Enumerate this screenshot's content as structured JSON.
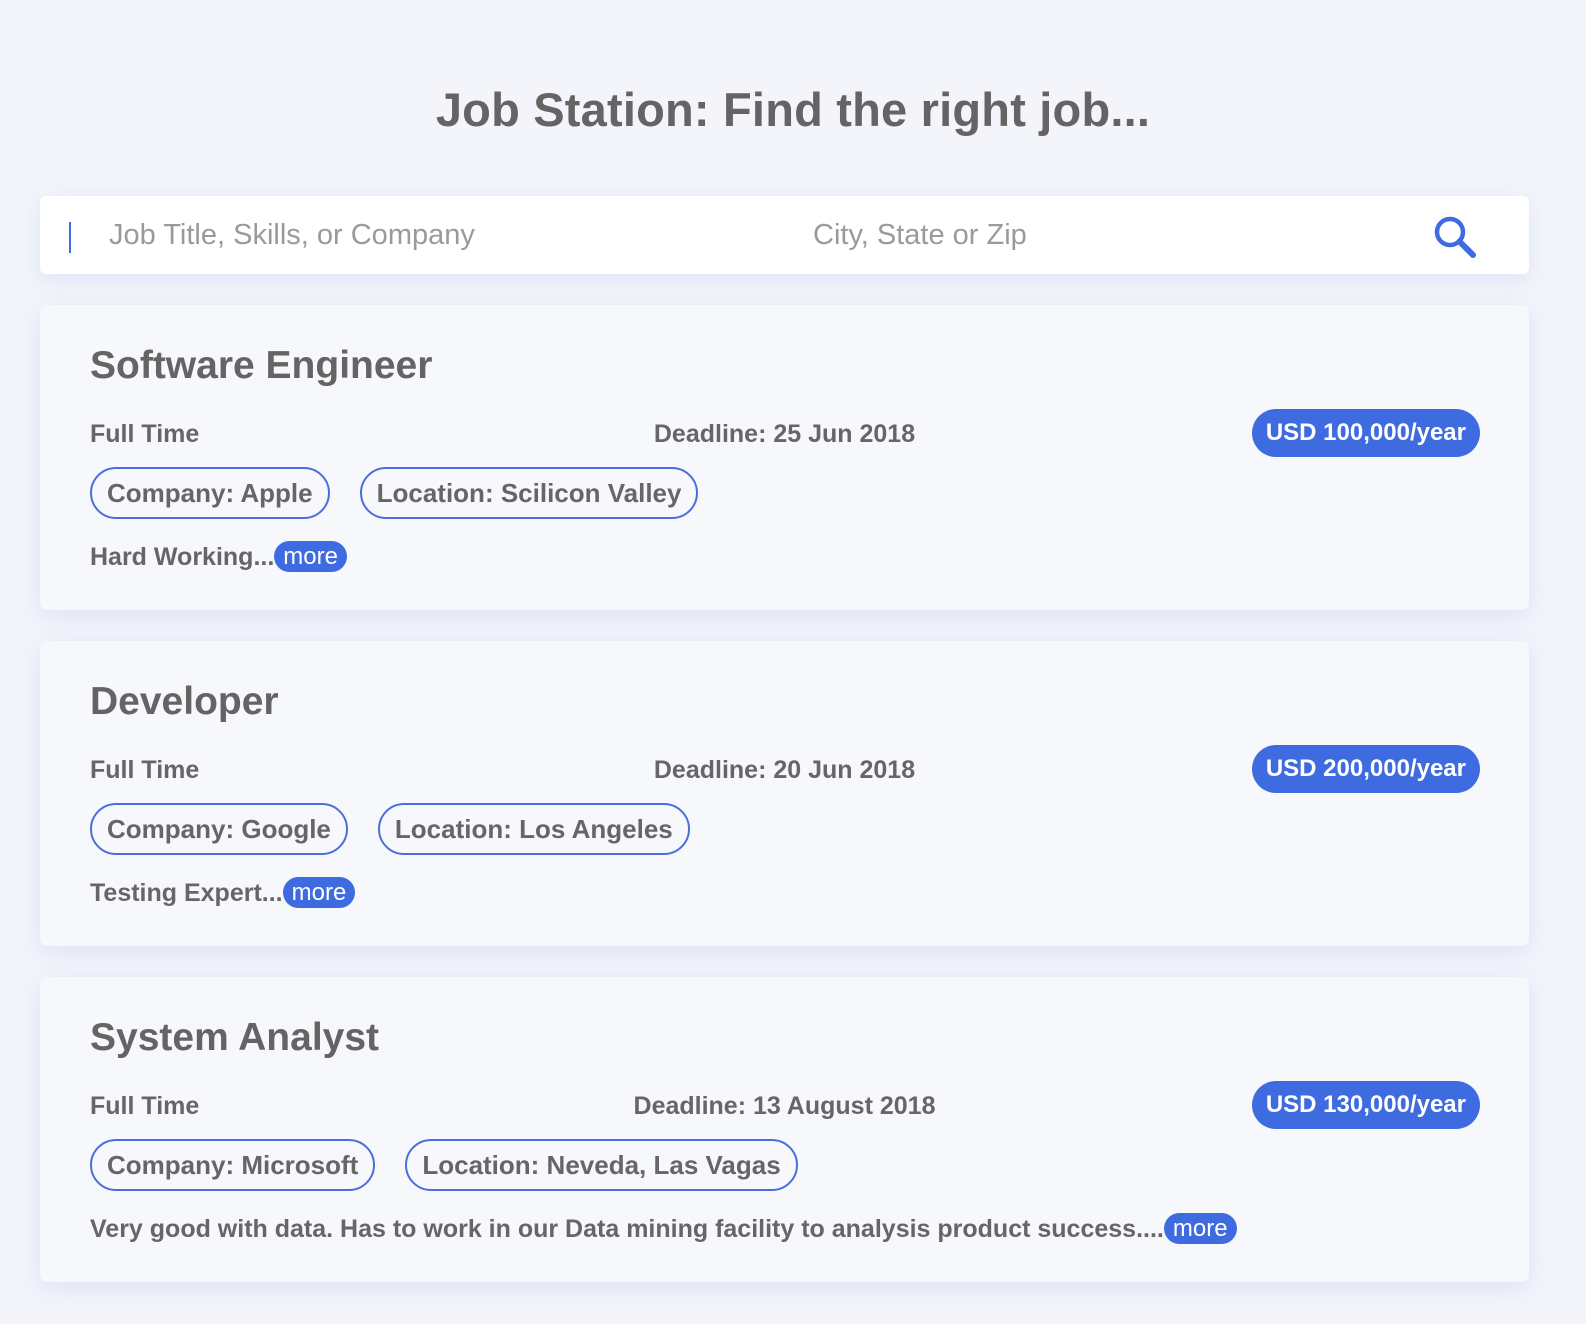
{
  "header": {
    "title": "Job Station: Find the right job..."
  },
  "search": {
    "job_placeholder": "Job Title, Skills, or Company",
    "location_placeholder": "City, State or Zip",
    "icon": "search-icon",
    "accent": "#3f6be0"
  },
  "jobs": [
    {
      "title": "Software Engineer",
      "type": "Full Time",
      "deadline": "Deadline: 25 Jun 2018",
      "salary": "USD 100,000/year",
      "company": "Company: Apple",
      "location": "Location: Scilicon Valley",
      "description": "Hard Working...",
      "more": "more"
    },
    {
      "title": "Developer",
      "type": "Full Time",
      "deadline": "Deadline: 20 Jun 2018",
      "salary": "USD 200,000/year",
      "company": "Company: Google",
      "location": "Location: Los Angeles",
      "description": "Testing Expert...",
      "more": "more"
    },
    {
      "title": "System Analyst",
      "type": "Full Time",
      "deadline": "Deadline: 13 August 2018",
      "salary": "USD 130,000/year",
      "company": "Company: Microsoft",
      "location": "Location: Neveda, Las Vagas",
      "description": "Very good with data. Has to work in our Data mining facility to analysis product success....",
      "more": "more"
    }
  ]
}
